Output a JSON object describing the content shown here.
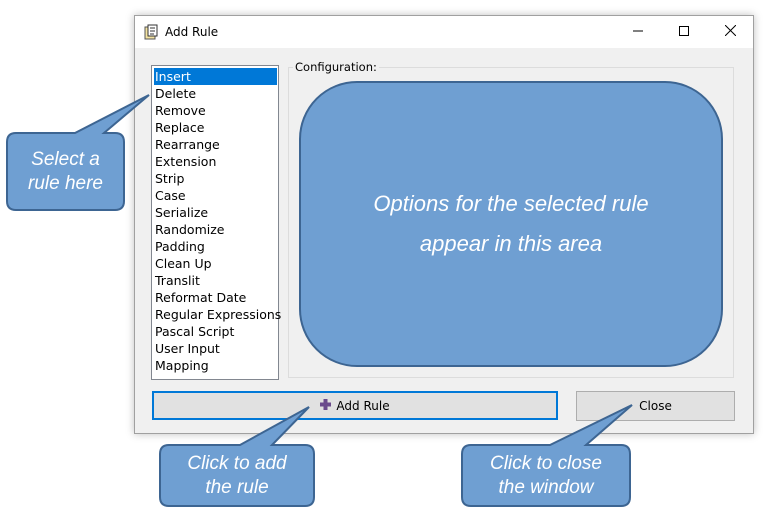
{
  "window": {
    "title": "Add Rule"
  },
  "rules_list": {
    "items": [
      "Insert",
      "Delete",
      "Remove",
      "Replace",
      "Rearrange",
      "Extension",
      "Strip",
      "Case",
      "Serialize",
      "Randomize",
      "Padding",
      "Clean Up",
      "Translit",
      "Reformat Date",
      "Regular Expressions",
      "Pascal Script",
      "User Input",
      "Mapping"
    ],
    "selected": "Insert"
  },
  "configuration": {
    "label": "Configuration:",
    "overlay_line1": "Options for the selected rule",
    "overlay_line2": "appear in this area"
  },
  "buttons": {
    "add_rule": "Add Rule",
    "close": "Close"
  },
  "callouts": {
    "select_rule_line1": "Select a",
    "select_rule_line2": "rule here",
    "add_rule_line1": "Click to add",
    "add_rule_line2": "the rule",
    "close_line1": "Click to close",
    "close_line2": "the window"
  },
  "colors": {
    "selection": "#0078d7",
    "callout_fill": "#6f9fd2",
    "callout_border": "#3d6592",
    "add_icon": "#6a4a8c"
  },
  "icons": {
    "app": "app-icon",
    "minimize": "minimize-icon",
    "maximize": "maximize-icon",
    "close": "close-icon",
    "add": "plus-icon"
  }
}
